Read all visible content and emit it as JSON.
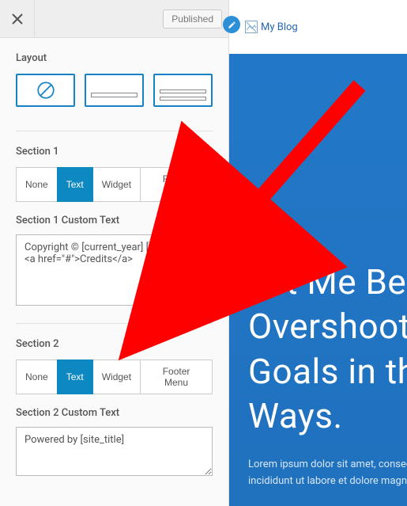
{
  "header": {
    "publish_label": "Published"
  },
  "layout": {
    "label": "Layout"
  },
  "section1": {
    "label": "Section 1",
    "options": {
      "none": "None",
      "text": "Text",
      "widget": "Widget",
      "footer_menu": "Footer Menu"
    },
    "custom_label": "Section 1 Custom Text",
    "custom_value": "Copyright © [current_year] [site_title] |\n<a href=\"#\">Credits</a>"
  },
  "section2": {
    "label": "Section 2",
    "options": {
      "none": "None",
      "text": "Text",
      "widget": "Widget",
      "footer_menu": "Footer Menu"
    },
    "custom_label": "Section 2 Custom Text",
    "custom_value": "Powered by [site_title]"
  },
  "preview": {
    "logo_alt": "My Blog",
    "hero_line1": "Let Me Be",
    "hero_line2": "Overshoot",
    "hero_line3": "Goals in the",
    "hero_line4": "Ways.",
    "hero_body1": "Lorem ipsum dolor sit amet, consec",
    "hero_body2": "incididunt ut labore et dolore magna"
  }
}
